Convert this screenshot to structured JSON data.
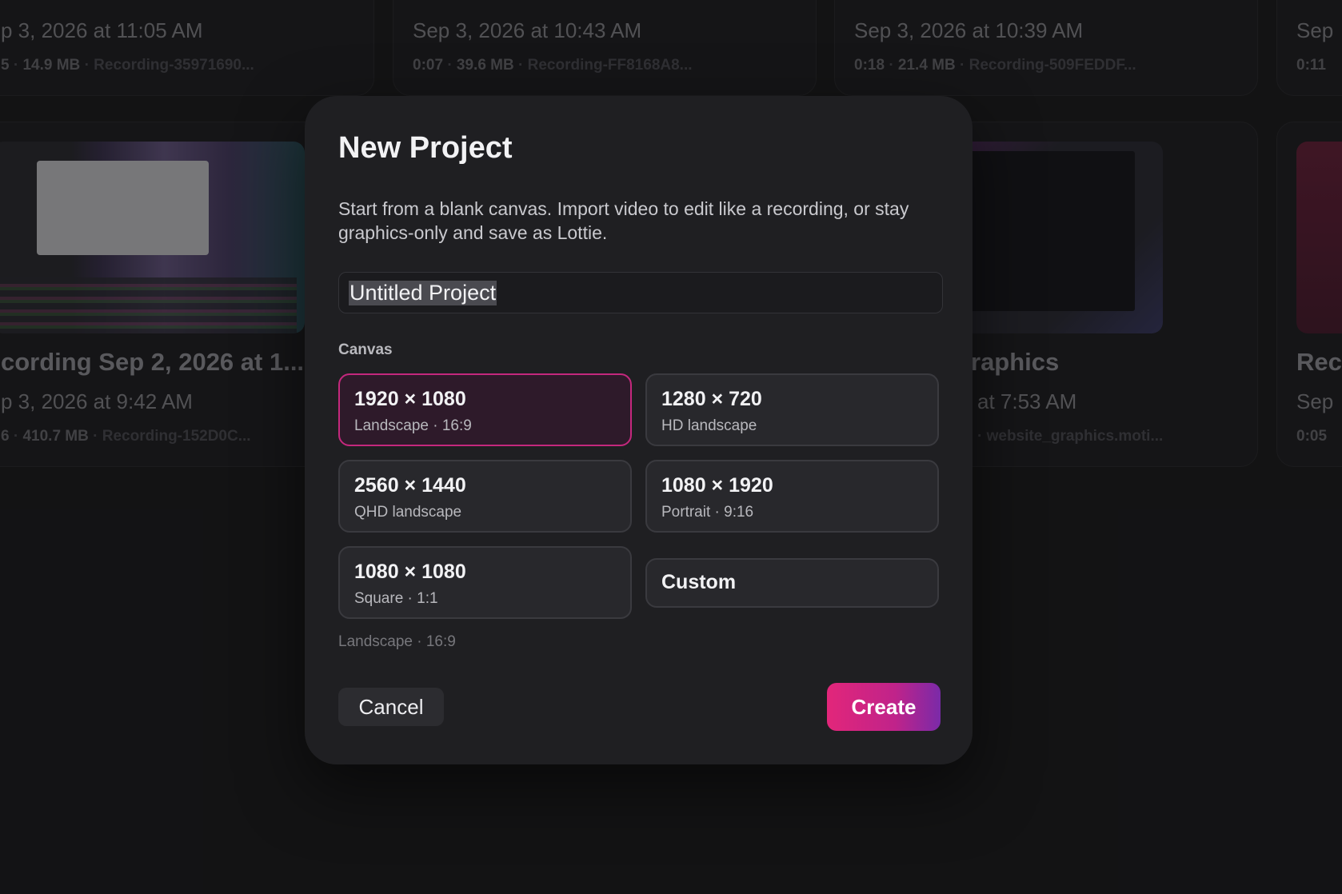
{
  "background": {
    "cards_top": [
      {
        "date": "p 3, 2026 at 11:05 AM",
        "duration": "5",
        "size": "14.9 MB",
        "file": "Recording-35971690..."
      },
      {
        "date": "Sep 3, 2026 at 10:43 AM",
        "duration": "0:07",
        "size": "39.6 MB",
        "file": "Recording-FF8168A8..."
      },
      {
        "date": "Sep 3, 2026 at 10:39 AM",
        "duration": "0:18",
        "size": "21.4 MB",
        "file": "Recording-509FEDDF..."
      },
      {
        "date": "Sep",
        "duration": "0:11"
      }
    ],
    "cards_bottom": [
      {
        "title": "cording Sep 2, 2026 at 1...",
        "date": "p 3, 2026 at 9:42 AM",
        "duration": "6",
        "size": "410.7 MB",
        "file": "Recording-152D0C..."
      },
      {
        "title": "raphics",
        "date": "at 7:53 AM",
        "file": "website_graphics.moti..."
      },
      {
        "title": "Rec",
        "date": "Sep",
        "duration": "0:05"
      }
    ]
  },
  "modal": {
    "title": "New Project",
    "description": "Start from a blank canvas. Import video to edit like a recording, or stay graphics-only and save as Lottie.",
    "name_value": "Untitled Project",
    "canvas_label": "Canvas",
    "options": [
      {
        "dims": "1920 × 1080",
        "sub": "Landscape · 16:9",
        "selected": true
      },
      {
        "dims": "1280 × 720",
        "sub": "HD landscape",
        "selected": false
      },
      {
        "dims": "2560 × 1440",
        "sub": "QHD landscape",
        "selected": false
      },
      {
        "dims": "1080 × 1920",
        "sub": "Portrait · 9:16",
        "selected": false
      },
      {
        "dims": "1080 × 1080",
        "sub": "Square · 1:1",
        "selected": false
      },
      {
        "dims": "Custom",
        "selected": false
      }
    ],
    "selected_hint": "Landscape · 16:9",
    "cancel_label": "Cancel",
    "create_label": "Create"
  },
  "colors": {
    "accent": "#c4287d",
    "create_gradient_start": "#e2267a",
    "create_gradient_end": "#7a2aa8",
    "modal_bg": "#1f1f22"
  }
}
